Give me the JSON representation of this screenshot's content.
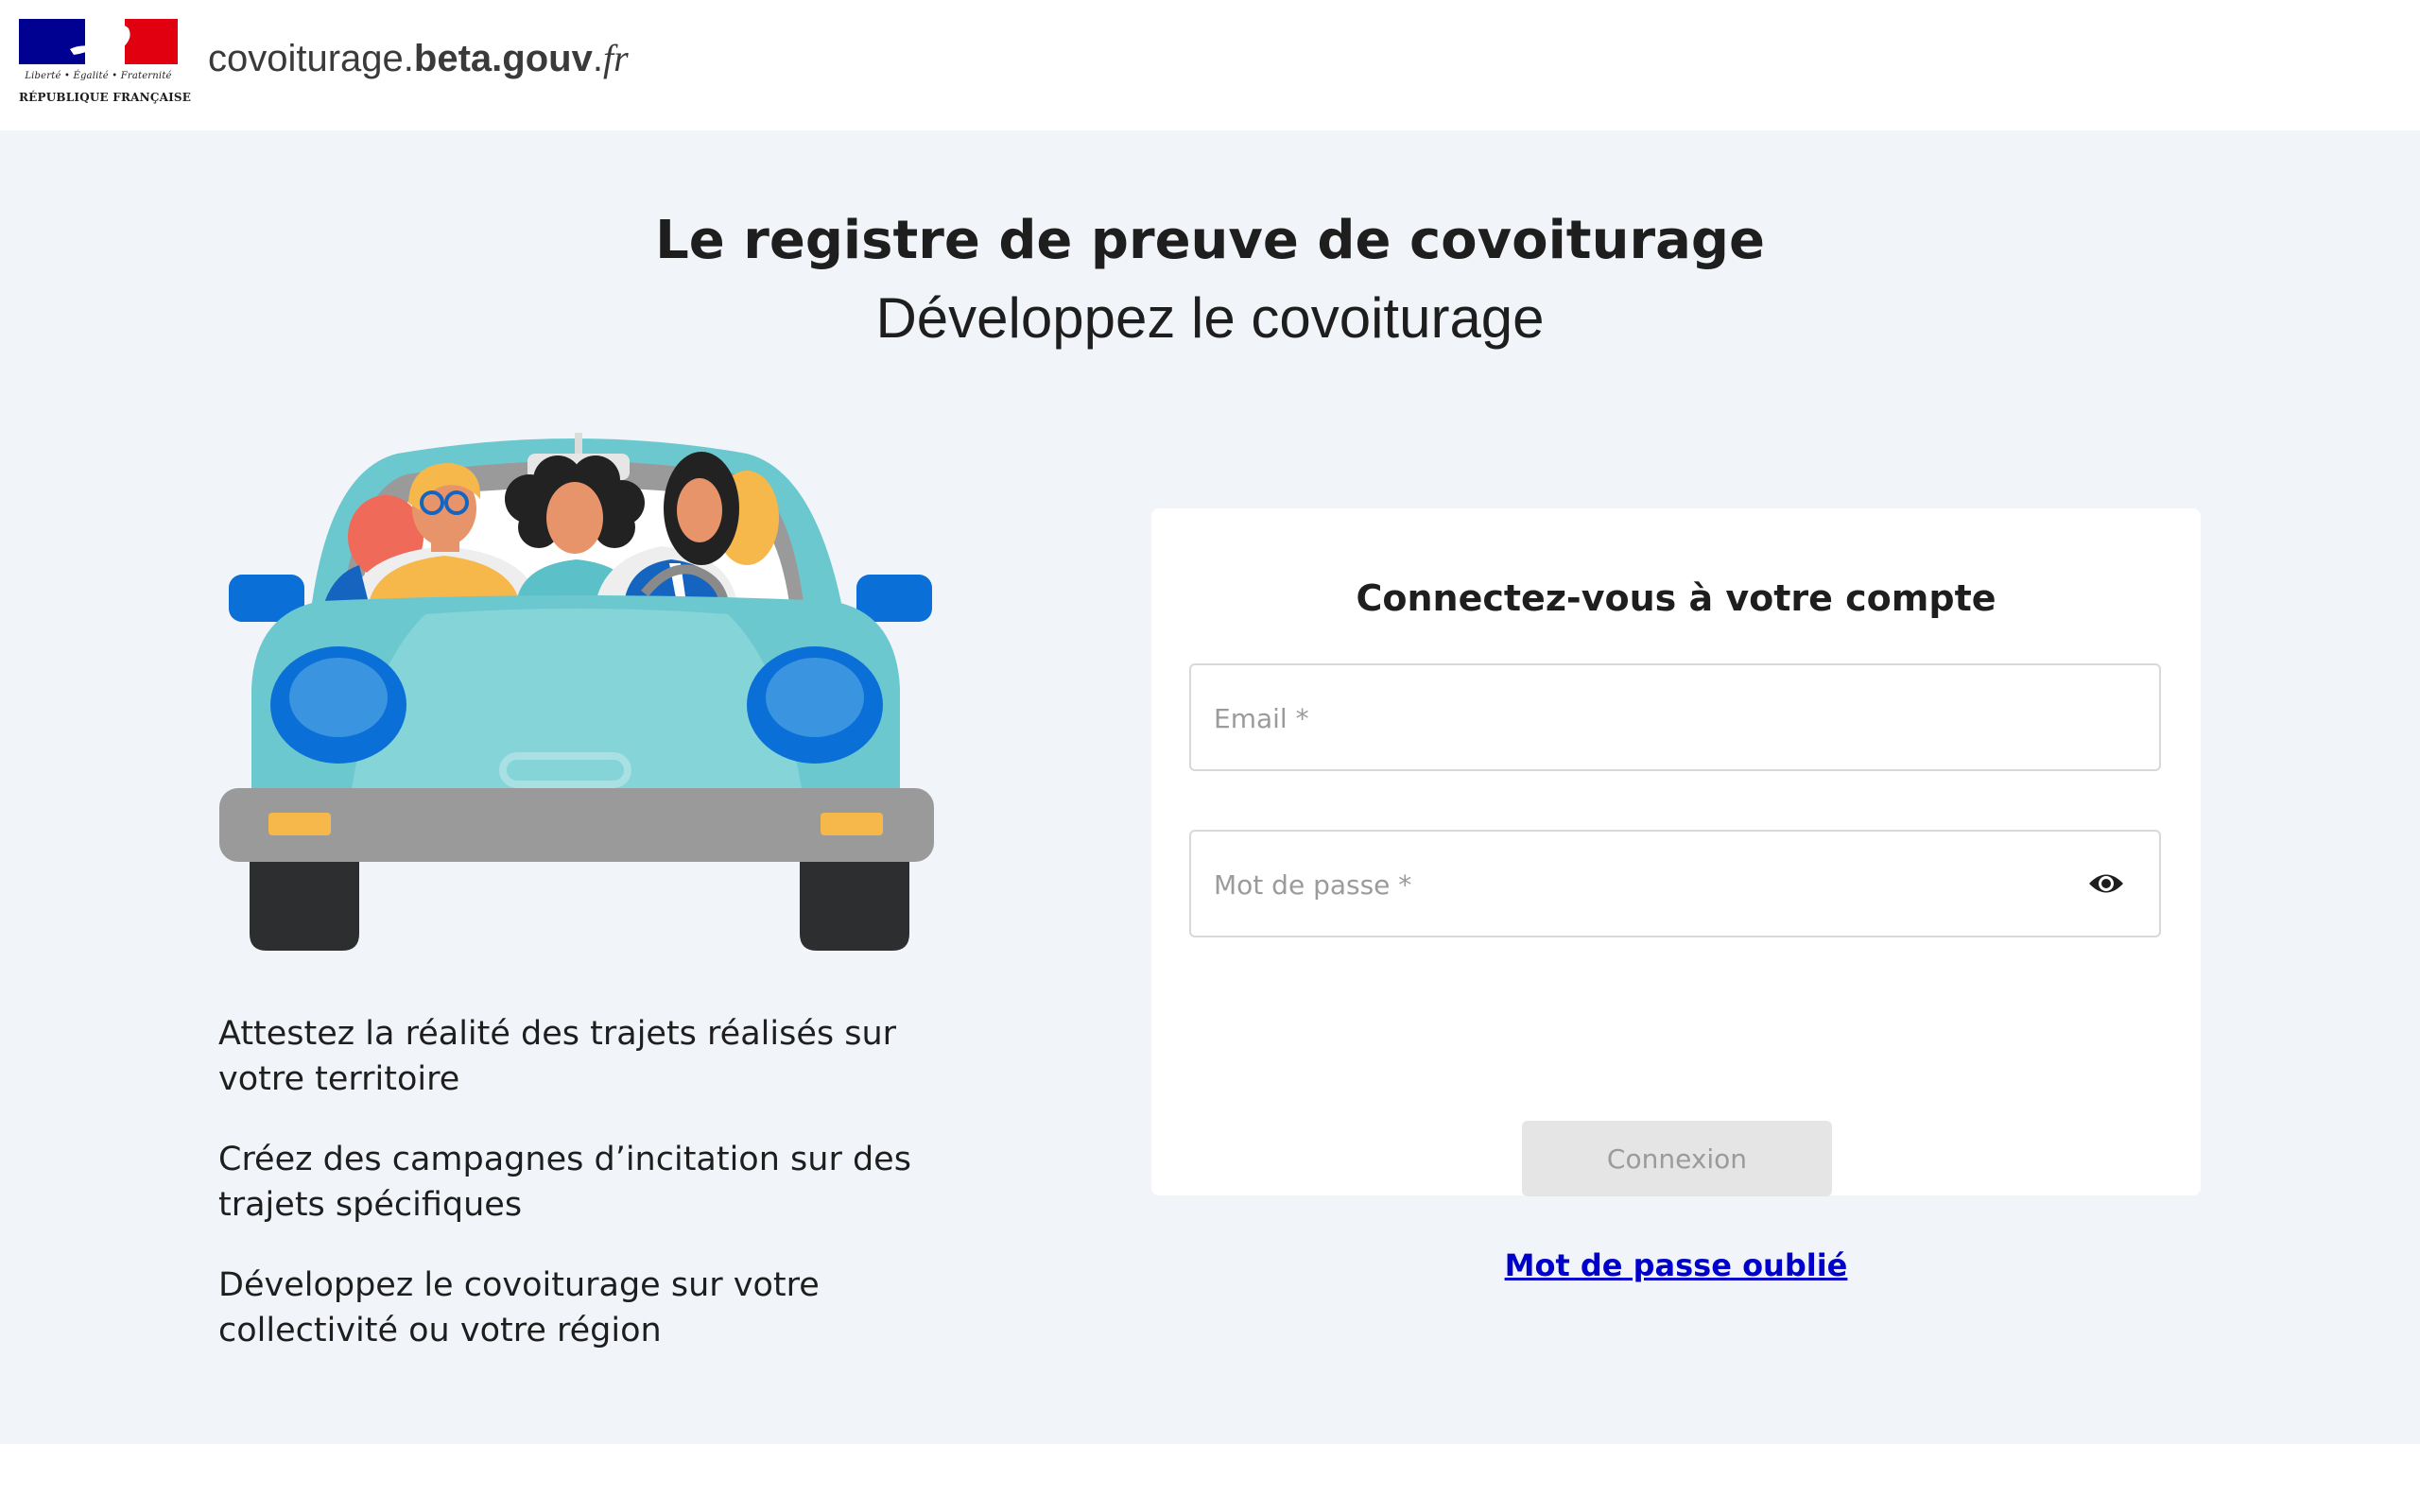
{
  "header": {
    "logo": {
      "motto": "Liberté • Égalité • Fraternité",
      "republique": "RÉPUBLIQUE FRANÇAISE"
    },
    "site_name": {
      "prefix": "covoiturage.",
      "bold": "beta.gouv",
      "dot": ".",
      "suffix": "fr"
    }
  },
  "hero": {
    "title": "Le registre de preuve de covoiturage",
    "subtitle": "Développez le covoiturage"
  },
  "features": [
    "Attestez la réalité des trajets réalisés sur votre territoire",
    "Créez des campagnes d’incitation sur des trajets spécifiques",
    "Développez le covoiturage sur votre collectivité ou votre région"
  ],
  "login": {
    "title": "Connectez-vous à votre compte",
    "email_placeholder": "Email *",
    "email_value": "",
    "password_placeholder": "Mot de passe *",
    "password_value": "",
    "password_toggle_icon": "eye-icon",
    "submit_label": "Connexion",
    "forgot_label": "Mot de passe oublié"
  },
  "colors": {
    "page_background": "#f1f4f9",
    "link": "#0000cc",
    "button_disabled_bg": "#e5e5e5",
    "button_disabled_text": "#9b9b9b",
    "flag_blue": "#000091",
    "flag_red": "#e1000f",
    "car_body": "#6cc8cf",
    "headlight": "#0a6fd6"
  }
}
